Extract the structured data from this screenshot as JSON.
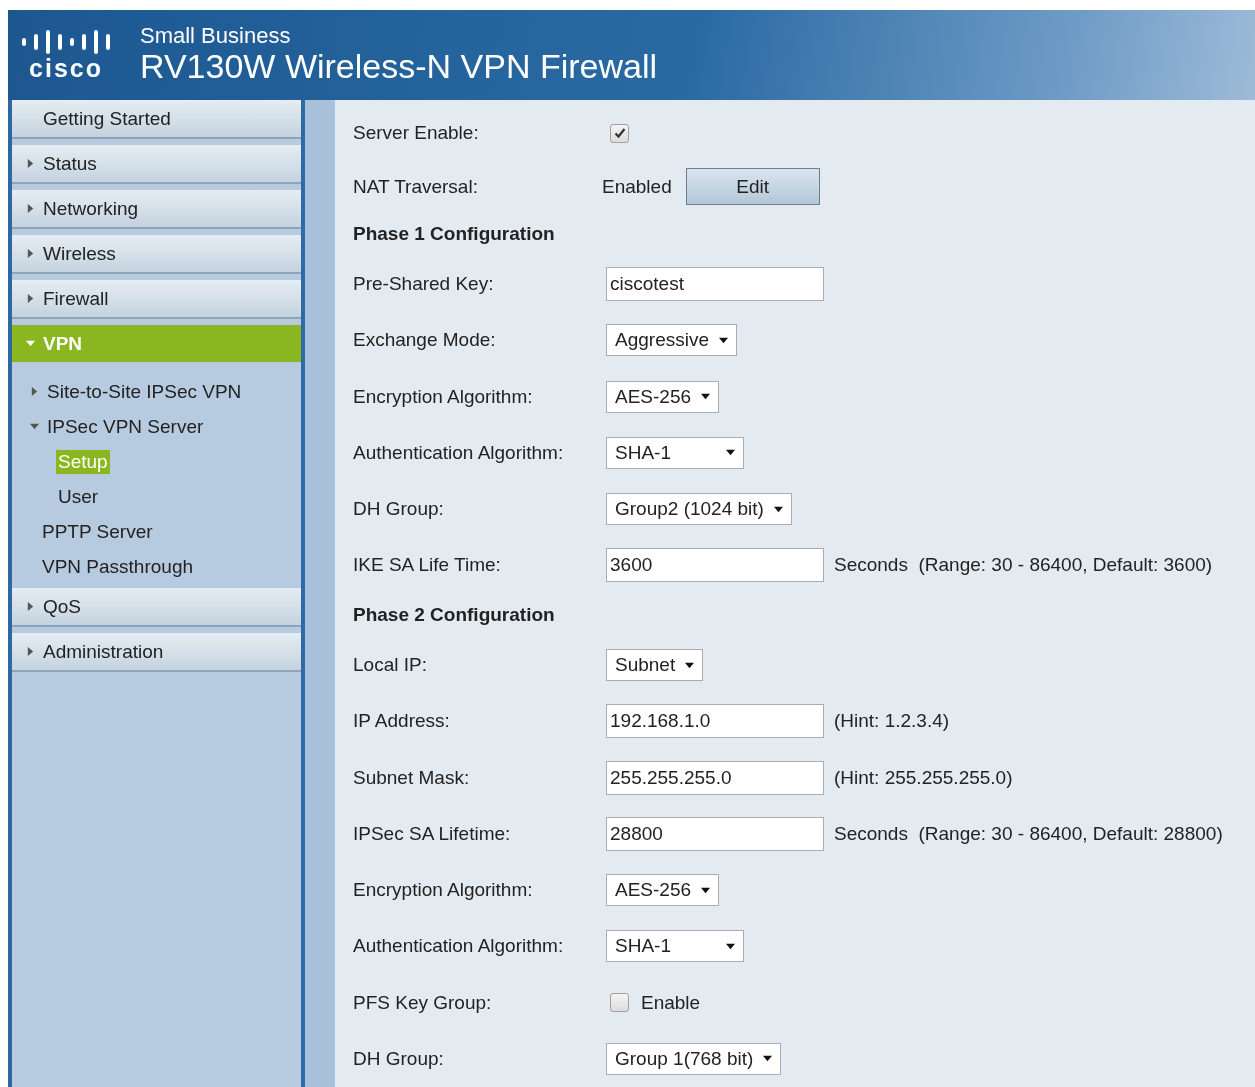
{
  "header": {
    "logo_text": "cisco",
    "subtitle": "Small Business",
    "title": "RV130W Wireless-N VPN Firewall"
  },
  "sidebar": {
    "items": [
      {
        "label": "Getting Started",
        "kind": "plain",
        "selected": false
      },
      {
        "label": "Status",
        "kind": "expandable",
        "expanded": false,
        "selected": false
      },
      {
        "label": "Networking",
        "kind": "expandable",
        "expanded": false,
        "selected": false
      },
      {
        "label": "Wireless",
        "kind": "expandable",
        "expanded": false,
        "selected": false
      },
      {
        "label": "Firewall",
        "kind": "expandable",
        "expanded": false,
        "selected": false
      },
      {
        "label": "VPN",
        "kind": "expandable",
        "expanded": true,
        "selected": true,
        "children": [
          {
            "label": "Site-to-Site IPSec VPN",
            "kind": "expandable",
            "expanded": false
          },
          {
            "label": "IPSec VPN Server",
            "kind": "expandable",
            "expanded": true,
            "children": [
              {
                "label": "Setup",
                "selected": true
              },
              {
                "label": "User",
                "selected": false
              }
            ]
          },
          {
            "label": "PPTP Server",
            "kind": "leaf",
            "expanded": false
          },
          {
            "label": "VPN Passthrough",
            "kind": "leaf",
            "expanded": false
          }
        ]
      },
      {
        "label": "QoS",
        "kind": "expandable",
        "expanded": false,
        "selected": false
      },
      {
        "label": "Administration",
        "kind": "expandable",
        "expanded": false,
        "selected": false
      }
    ]
  },
  "form": {
    "rows": [
      {
        "kind": "checkbox",
        "label": "Server Enable:",
        "checked": true
      },
      {
        "kind": "status",
        "label": "NAT Traversal:",
        "value": "Enabled",
        "button": "Edit"
      },
      {
        "kind": "heading",
        "label": "Phase 1 Configuration"
      },
      {
        "kind": "text",
        "label": "Pre-Shared Key:",
        "value": "ciscotest"
      },
      {
        "kind": "select",
        "label": "Exchange Mode:",
        "value": "Aggressive"
      },
      {
        "kind": "select",
        "label": "Encryption Algorithm:",
        "value": "AES-256"
      },
      {
        "kind": "select",
        "label": "Authentication Algorithm:",
        "value": "SHA-1",
        "wide": true
      },
      {
        "kind": "select",
        "label": "DH Group:",
        "value": "Group2 (1024 bit)"
      },
      {
        "kind": "text",
        "label": "IKE SA Life Time:",
        "value": "3600",
        "note": "Seconds  (Range: 30 - 86400, Default: 3600)"
      },
      {
        "kind": "heading",
        "label": "Phase 2 Configuration"
      },
      {
        "kind": "select",
        "label": "Local IP:",
        "value": "Subnet"
      },
      {
        "kind": "text",
        "label": "IP Address:",
        "value": "192.168.1.0",
        "note": "(Hint: 1.2.3.4)"
      },
      {
        "kind": "text",
        "label": "Subnet Mask:",
        "value": "255.255.255.0",
        "note": "(Hint: 255.255.255.0)"
      },
      {
        "kind": "text",
        "label": "IPSec SA Lifetime:",
        "value": "28800",
        "note": "Seconds  (Range: 30 - 86400, Default: 28800)"
      },
      {
        "kind": "select",
        "label": "Encryption Algorithm:",
        "value": "AES-256"
      },
      {
        "kind": "select",
        "label": "Authentication Algorithm:",
        "value": "SHA-1",
        "wide": true
      },
      {
        "kind": "checkbox",
        "label": "PFS Key Group:",
        "checked": false,
        "option": "Enable"
      },
      {
        "kind": "select",
        "label": "DH Group:",
        "value": "Group 1(768 bit)"
      }
    ]
  }
}
